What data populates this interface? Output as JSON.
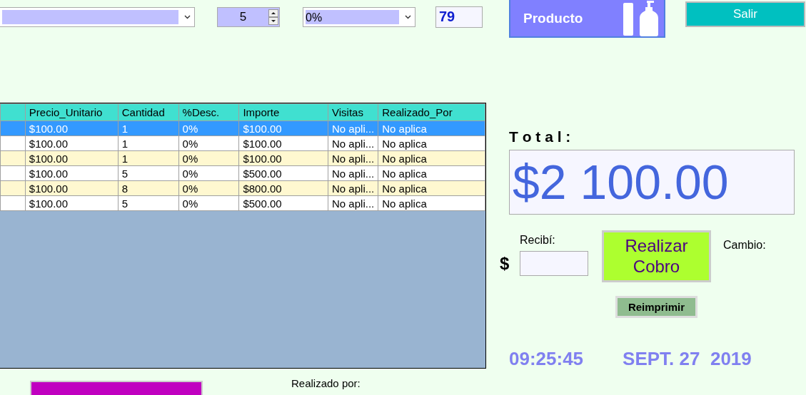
{
  "top_controls": {
    "quantity": {
      "value": "5"
    },
    "discount_select": {
      "value": "0%"
    },
    "stock": {
      "value": "79"
    }
  },
  "product_button": {
    "label": "Producto"
  },
  "exit_button": {
    "label": "Salir"
  },
  "table": {
    "columns": [
      "Precio_Unitario",
      "Cantidad",
      "%Desc.",
      "Importe",
      "Visitas",
      "Realizado_Por"
    ],
    "rows": [
      {
        "selected": true,
        "cells": [
          "$100.00",
          "1",
          "0%",
          "$100.00",
          "No apli...",
          "No aplica"
        ]
      },
      {
        "selected": false,
        "cells": [
          "$100.00",
          "1",
          "0%",
          "$100.00",
          "No apli...",
          "No aplica"
        ]
      },
      {
        "selected": false,
        "cells": [
          "$100.00",
          "1",
          "0%",
          "$100.00",
          "No apli...",
          "No aplica"
        ]
      },
      {
        "selected": false,
        "cells": [
          "$100.00",
          "5",
          "0%",
          "$500.00",
          "No apli...",
          "No aplica"
        ]
      },
      {
        "selected": false,
        "cells": [
          "$100.00",
          "8",
          "0%",
          "$800.00",
          "No apli...",
          "No aplica"
        ]
      },
      {
        "selected": false,
        "cells": [
          "$100.00",
          "5",
          "0%",
          "$500.00",
          "No apli...",
          "No aplica"
        ]
      }
    ]
  },
  "total": {
    "label": "T o t a l :",
    "value": "$2 100.00"
  },
  "payment": {
    "received_label": "Recibí:",
    "currency": "$",
    "charge_button": "Realizar Cobro",
    "change_label": "Cambio:",
    "reprint_button": "Reimprimir"
  },
  "clock": {
    "time": "09:25:45",
    "date": "SEPT. 27  2019"
  },
  "footer": {
    "done_by_label": "Realizado por:"
  }
}
